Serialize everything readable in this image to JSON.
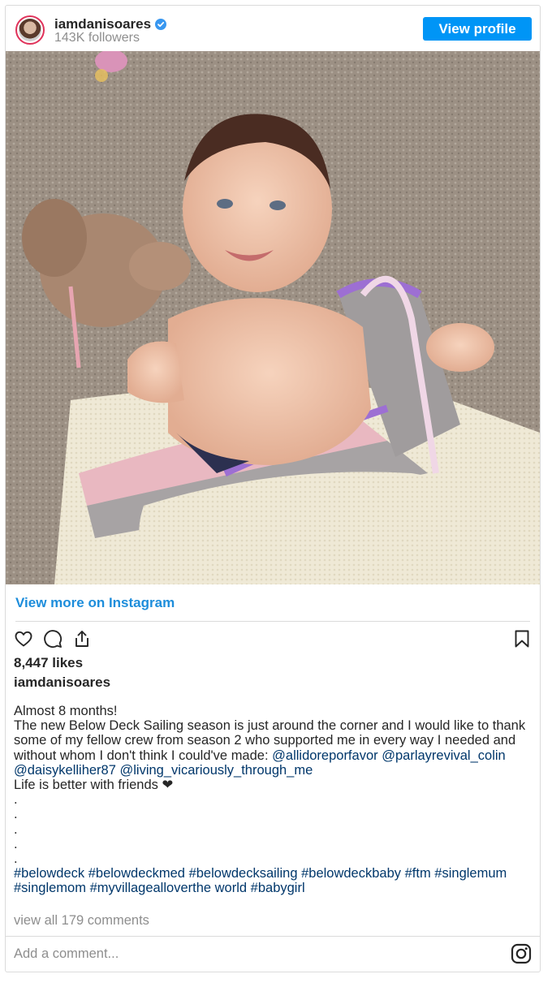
{
  "header": {
    "username": "iamdanisoares",
    "followers": "143K followers",
    "view_profile_label": "View profile"
  },
  "post": {
    "image_subject": "baby-lying-on-carpet-with-knitted-blanket-and-plush-toy",
    "view_more_label": "View more on Instagram",
    "likes": "8,447 likes",
    "owner": "iamdanisoares",
    "caption": {
      "line1": "Almost 8 months!",
      "body": "The new Below Deck Sailing season is just around the corner and I would like to thank some of my fellow crew from season 2 who supported me in every way I needed and without whom I don't think I could've made: ",
      "mentions": [
        "@allidoreporfavor",
        "@parlayrevival_colin",
        "@daisykelliher87",
        "@living_vicariously_through_me"
      ],
      "friends_line": "Life is better with friends ❤",
      "dots": [
        ".",
        ".",
        ".",
        ".",
        "."
      ],
      "hashtags": [
        "#belowdeck",
        "#belowdeckmed",
        "#belowdecksailing",
        "#belowdeckbaby",
        "#ftm",
        "#singlemum",
        "#singlemom",
        "#myvillagealloverthe world",
        "#babygirl"
      ]
    },
    "comments_link": "view all 179 comments",
    "add_comment_placeholder": "Add a comment..."
  },
  "icons": [
    "verified-badge-icon",
    "heart-icon",
    "comment-icon",
    "share-icon",
    "bookmark-icon",
    "instagram-icon"
  ],
  "colors": {
    "accent": "#0095f6",
    "link": "#00376b",
    "view_more": "#1d8ddb",
    "muted": "#8e8e8e"
  }
}
